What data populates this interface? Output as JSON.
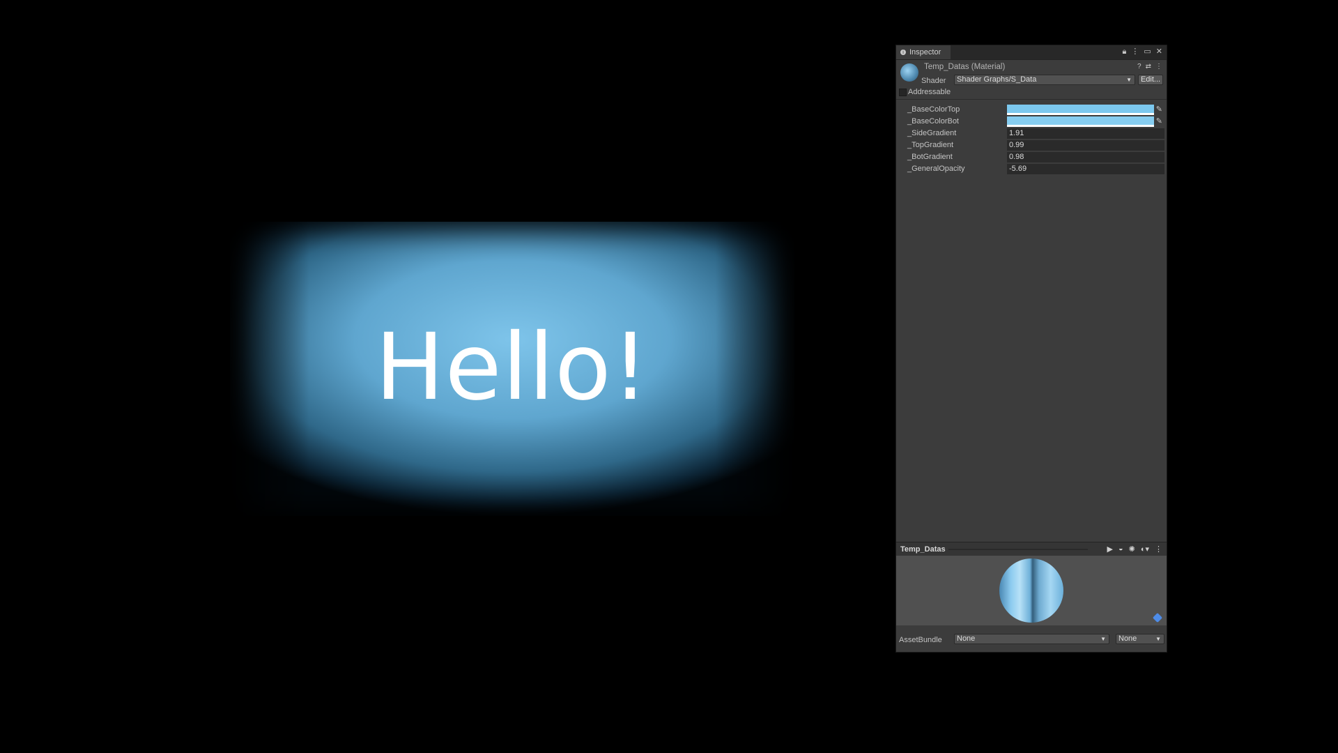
{
  "scene": {
    "text": "Hello!"
  },
  "inspector": {
    "tab_label": "Inspector",
    "material_name": "Temp_Datas (Material)",
    "shader_label": "Shader",
    "shader_value": "Shader Graphs/S_Data",
    "edit_button": "Edit...",
    "addressable_label": "Addressable",
    "addressable_checked": false,
    "properties": [
      {
        "name": "_BaseColorTop",
        "type": "color",
        "color": "#7cc8ee"
      },
      {
        "name": "_BaseColorBot",
        "type": "color",
        "color": "#86cdf0"
      },
      {
        "name": "_SideGradient",
        "type": "float",
        "value": "1.91"
      },
      {
        "name": "_TopGradient",
        "type": "float",
        "value": "0.99"
      },
      {
        "name": "_BotGradient",
        "type": "float",
        "value": "0.98"
      },
      {
        "name": "_GeneralOpacity",
        "type": "float",
        "value": "-5.69"
      }
    ],
    "preview": {
      "name": "Temp_Datas"
    },
    "asset_bundle": {
      "label": "AssetBundle",
      "value": "None",
      "variant": "None"
    }
  }
}
